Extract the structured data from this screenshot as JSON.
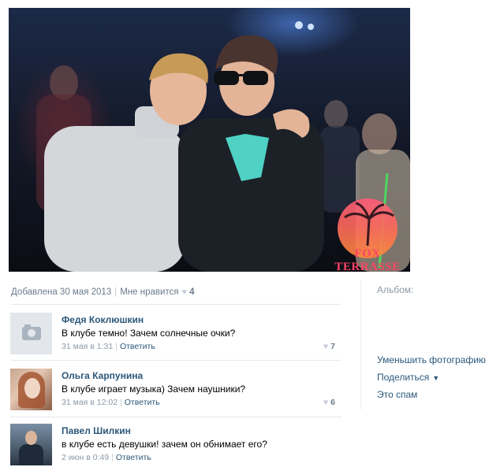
{
  "photo": {
    "watermark": "FOX TERRASSE"
  },
  "meta": {
    "added": "Добавлена 30 мая 2013",
    "like_label": "Мне нравится",
    "like_icon": "heart-icon",
    "like_count": "4"
  },
  "comments": [
    {
      "author": "Федя Коклюшкин",
      "text": "В клубе темно! Зачем солнечные очки?",
      "time": "31 мая в 1:31",
      "reply": "Ответить",
      "likes": "7",
      "avatar": "camera-icon"
    },
    {
      "author": "Ольга Карпунина",
      "text": "В клубе играет музыка) Зачем наушники?",
      "time": "31 мая в 12:02",
      "reply": "Ответить",
      "likes": "6",
      "avatar": "user-photo"
    },
    {
      "author": "Павел Шилкин",
      "text": "в клубе есть девушки! зачем он обнимает его?",
      "time": "2 июн в 0:49",
      "reply": "Ответить",
      "likes": "",
      "avatar": "user-photo"
    }
  ],
  "sidebar": {
    "album_label": "Альбом:",
    "shrink": "Уменьшить фотографию",
    "share": "Поделиться",
    "spam": "Это спам"
  },
  "colors": {
    "link": "#2b587a",
    "muted": "#8d99a8",
    "heart": "#c5ccd6"
  }
}
